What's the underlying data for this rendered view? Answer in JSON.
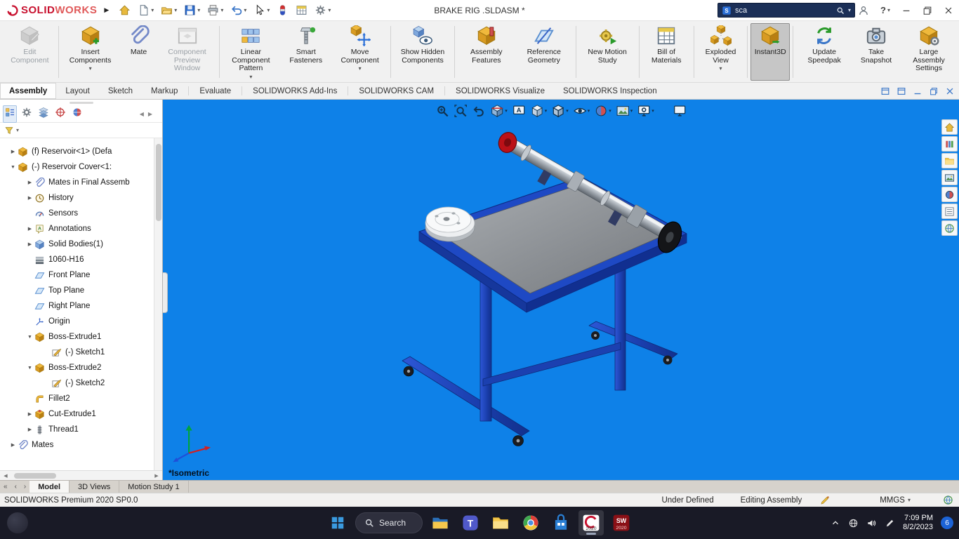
{
  "colors": {
    "brand_red": "#c8102e",
    "viewport_blue": "#0e81e8",
    "frame_blue": "#1e49c4",
    "taskbar_dark": "#191a26",
    "search_navy": "#1b2f57"
  },
  "ui": {
    "caret": "▾",
    "collapsed": "▶",
    "expanded": "▼",
    "nav_first": "«",
    "nav_prev": "‹",
    "nav_next": "›",
    "panel_left": "◀",
    "panel_right": "▶",
    "expand_arrow": "▶"
  },
  "titlebar": {
    "logo_solid": "SOLID",
    "logo_works": "WORKS",
    "title": "BRAKE RIG .SLDASM *",
    "search_value": "sca",
    "help_label": "?",
    "tools": [
      {
        "id": "home",
        "caret": false
      },
      {
        "id": "new-document",
        "caret": true
      },
      {
        "id": "open",
        "caret": true
      },
      {
        "id": "save",
        "caret": true
      },
      {
        "id": "print",
        "caret": true
      },
      {
        "id": "undo",
        "caret": true
      },
      {
        "id": "select",
        "caret": true
      },
      {
        "id": "selection-filter",
        "caret": false
      },
      {
        "id": "task-scheduler",
        "caret": false
      },
      {
        "id": "options",
        "caret": true
      }
    ]
  },
  "ribbon": {
    "buttons": [
      {
        "id": "edit-component",
        "label": "Edit Component",
        "disabled": true,
        "sep": true
      },
      {
        "id": "insert-components",
        "label": "Insert Components",
        "caret": true
      },
      {
        "id": "mate",
        "label": "Mate"
      },
      {
        "id": "component-preview-window",
        "label": "Component Preview Window",
        "disabled": true,
        "sep": true
      },
      {
        "id": "linear-component-pattern",
        "label": "Linear Component Pattern",
        "caret": true
      },
      {
        "id": "smart-fasteners",
        "label": "Smart Fasteners"
      },
      {
        "id": "move-component",
        "label": "Move Component",
        "caret": true,
        "sep": true
      },
      {
        "id": "show-hidden-components",
        "label": "Show Hidden Components",
        "sep": true
      },
      {
        "id": "assembly-features",
        "label": "Assembly Features"
      },
      {
        "id": "reference-geometry",
        "label": "Reference Geometry",
        "sep": true
      },
      {
        "id": "new-motion-study",
        "label": "New Motion Study",
        "sep": true
      },
      {
        "id": "bill-of-materials",
        "label": "Bill of Materials",
        "sep": true
      },
      {
        "id": "exploded-view",
        "label": "Exploded View",
        "caret": true,
        "sep": true
      },
      {
        "id": "instant3d",
        "label": "Instant3D",
        "active": true,
        "sep": true
      },
      {
        "id": "update-speedpak",
        "label": "Update Speedpak"
      },
      {
        "id": "take-snapshot",
        "label": "Take Snapshot"
      },
      {
        "id": "large-assembly-settings",
        "label": "Large Assembly Settings"
      }
    ]
  },
  "ribbon_tabs": {
    "items": [
      {
        "label": "Assembly",
        "active": true
      },
      {
        "label": "Layout"
      },
      {
        "label": "Sketch"
      },
      {
        "label": "Markup"
      },
      {
        "label": "Evaluate",
        "sep": true
      },
      {
        "label": "SOLIDWORKS Add-Ins",
        "sep": true
      },
      {
        "label": "SOLIDWORKS CAM",
        "sep": true
      },
      {
        "label": "SOLIDWORKS Visualize",
        "sep": true
      },
      {
        "label": "SOLIDWORKS Inspection"
      }
    ]
  },
  "left_panel": {
    "tabs": [
      "feature-manager",
      "property-manager",
      "configuration-manager",
      "dimxpert-manager",
      "display-manager"
    ],
    "tree": [
      {
        "label": "(f) Reservoir<1> (Defa",
        "icon": "component",
        "arrow": "right",
        "indent": 0
      },
      {
        "label": "(-) Reservoir Cover<1:",
        "icon": "component",
        "arrow": "down",
        "indent": 0
      },
      {
        "label": "Mates in Final Assemb",
        "icon": "mates-folder",
        "arrow": "right",
        "indent": 1
      },
      {
        "label": "History",
        "icon": "history",
        "arrow": "right",
        "indent": 1
      },
      {
        "label": "Sensors",
        "icon": "sensors",
        "arrow": "",
        "indent": 1
      },
      {
        "label": "Annotations",
        "icon": "annotations",
        "arrow": "right",
        "indent": 1
      },
      {
        "label": "Solid Bodies(1)",
        "icon": "solid-bodies",
        "arrow": "right",
        "indent": 1
      },
      {
        "label": "1060-H16",
        "icon": "material",
        "arrow": "",
        "indent": 1
      },
      {
        "label": "Front Plane",
        "icon": "plane",
        "arrow": "",
        "indent": 1
      },
      {
        "label": "Top Plane",
        "icon": "plane",
        "arrow": "",
        "indent": 1
      },
      {
        "label": "Right Plane",
        "icon": "plane",
        "arrow": "",
        "indent": 1
      },
      {
        "label": "Origin",
        "icon": "origin",
        "arrow": "",
        "indent": 1
      },
      {
        "label": "Boss-Extrude1",
        "icon": "boss-extrude",
        "arrow": "down",
        "indent": 1
      },
      {
        "label": "(-) Sketch1",
        "icon": "sketch",
        "arrow": "",
        "indent": 2
      },
      {
        "label": "Boss-Extrude2",
        "icon": "boss-extrude",
        "arrow": "down",
        "indent": 1
      },
      {
        "label": "(-) Sketch2",
        "icon": "sketch",
        "arrow": "",
        "indent": 2
      },
      {
        "label": "Fillet2",
        "icon": "fillet",
        "arrow": "",
        "indent": 1
      },
      {
        "label": "Cut-Extrude1",
        "icon": "cut-extrude",
        "arrow": "right",
        "indent": 1
      },
      {
        "label": "Thread1",
        "icon": "thread",
        "arrow": "right",
        "indent": 1
      },
      {
        "label": "Mates",
        "icon": "mates-folder",
        "arrow": "right",
        "indent": 0
      }
    ]
  },
  "viewport": {
    "view_label": "*Isometric",
    "headsup": [
      {
        "id": "zoom-to-fit"
      },
      {
        "id": "zoom-to-area"
      },
      {
        "id": "previous-view"
      },
      {
        "id": "section-view",
        "caret": true
      },
      {
        "id": "dynamic-annotation-views"
      },
      {
        "id": "view-orientation",
        "caret": true
      },
      {
        "id": "display-style",
        "caret": true
      },
      {
        "id": "hide-show-items",
        "caret": true
      },
      {
        "id": "edit-appearance",
        "caret": true
      },
      {
        "id": "apply-scene",
        "caret": true
      },
      {
        "id": "view-settings",
        "caret": true
      },
      {
        "id": "preview-window",
        "gap": true
      }
    ],
    "task_pane": [
      "home",
      "design-library",
      "file-explorer",
      "view-palette",
      "appearances",
      "custom-properties",
      "solidworks-resources"
    ]
  },
  "doc_tabs": {
    "items": [
      {
        "label": "Model",
        "active": true
      },
      {
        "label": "3D Views"
      },
      {
        "label": "Motion Study 1"
      }
    ]
  },
  "statusbar": {
    "product": "SOLIDWORKS Premium 2020 SP0.0",
    "constraint_status": "Under Defined",
    "mode": "Editing Assembly",
    "units": "MMGS"
  },
  "taskbar": {
    "search_label": "Search",
    "apps": [
      {
        "id": "file-explorer"
      },
      {
        "id": "teams"
      },
      {
        "id": "folder"
      },
      {
        "id": "browser"
      },
      {
        "id": "store"
      },
      {
        "id": "solidworks-2020",
        "active": true
      },
      {
        "id": "solidworks-rx-2020"
      }
    ],
    "time": "7:09 PM",
    "date": "8/2/2023",
    "notification_count": "6"
  }
}
